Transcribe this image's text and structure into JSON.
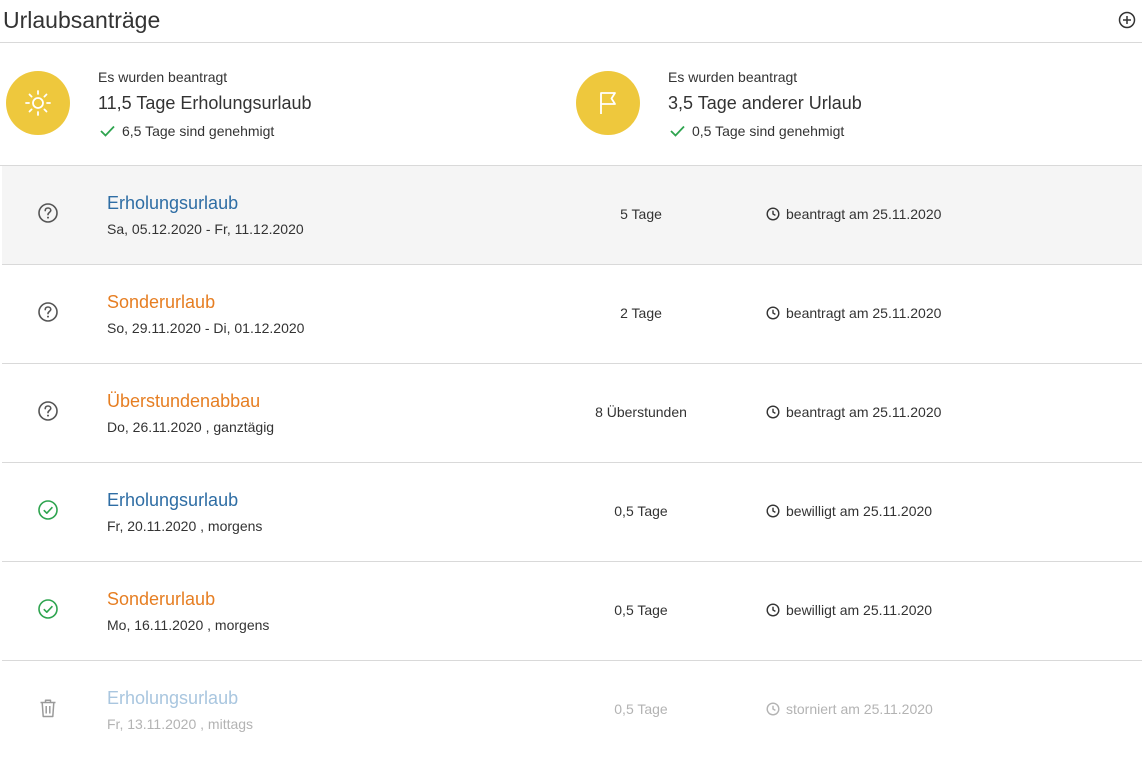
{
  "header": {
    "title": "Urlaubsanträge",
    "add_icon": "plus-circle-icon"
  },
  "summary": [
    {
      "icon": "sun-icon",
      "intro": "Es wurden beantragt",
      "main": "11,5 Tage Erholungsurlaub",
      "approved": "6,5 Tage sind genehmigt"
    },
    {
      "icon": "flag-icon",
      "intro": "Es wurden beantragt",
      "main": "3,5 Tage anderer Urlaub",
      "approved": "0,5 Tage sind genehmigt"
    }
  ],
  "colors": {
    "accent_yellow": "#eec83d",
    "type_blue": "#2e6da4",
    "type_orange": "#e67e22",
    "approved_green": "#2ea44f"
  },
  "requests": [
    {
      "status_icon": "question-circle-icon",
      "type": "Erholungsurlaub",
      "date": "Sa, 05.12.2020 - Fr, 11.12.2020",
      "amount": "5 Tage",
      "status": "beantragt am 25.11.2020"
    },
    {
      "status_icon": "question-circle-icon",
      "type": "Sonderurlaub",
      "date": "So, 29.11.2020 - Di, 01.12.2020",
      "amount": "2 Tage",
      "status": "beantragt am 25.11.2020"
    },
    {
      "status_icon": "question-circle-icon",
      "type": "Überstundenabbau",
      "date": "Do, 26.11.2020 , ganztägig",
      "amount": "8 Überstunden",
      "status": "beantragt am 25.11.2020"
    },
    {
      "status_icon": "check-circle-icon",
      "type": "Erholungsurlaub",
      "date": "Fr, 20.11.2020 , morgens",
      "amount": "0,5 Tage",
      "status": "bewilligt am 25.11.2020"
    },
    {
      "status_icon": "check-circle-icon",
      "type": "Sonderurlaub",
      "date": "Mo, 16.11.2020 , morgens",
      "amount": "0,5 Tage",
      "status": "bewilligt am 25.11.2020"
    },
    {
      "status_icon": "trash-icon",
      "type": "Erholungsurlaub",
      "date": "Fr, 13.11.2020 , mittags",
      "amount": "0,5 Tage",
      "status": "storniert am 25.11.2020"
    }
  ]
}
